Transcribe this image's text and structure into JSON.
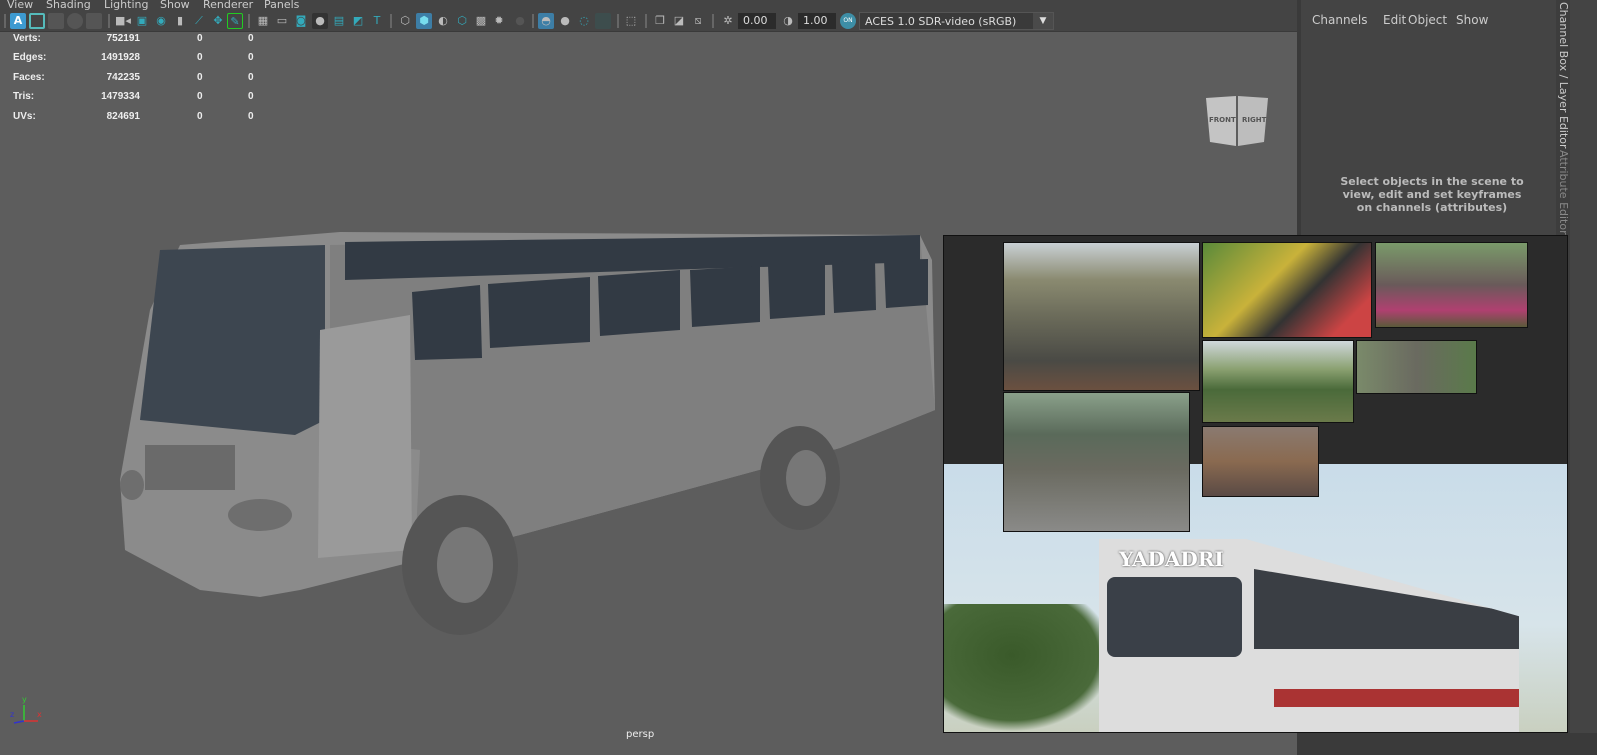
{
  "menubar": {
    "items": [
      "View",
      "Shading",
      "Lighting",
      "Show",
      "Renderer",
      "Panels"
    ]
  },
  "toolbar": {
    "exposure": "0.00",
    "gamma": "1.00",
    "color_mgmt_toggle": "ON",
    "color_space": "ACES 1.0 SDR-video (sRGB)"
  },
  "stats": [
    {
      "label": "Verts:",
      "total": "752191",
      "sel": "0",
      "comp": "0"
    },
    {
      "label": "Edges:",
      "total": "1491928",
      "sel": "0",
      "comp": "0"
    },
    {
      "label": "Faces:",
      "total": "742235",
      "sel": "0",
      "comp": "0"
    },
    {
      "label": "Tris:",
      "total": "1479334",
      "sel": "0",
      "comp": "0"
    },
    {
      "label": "UVs:",
      "total": "824691",
      "sel": "0",
      "comp": "0"
    }
  ],
  "viewcube": {
    "front": "FRONT",
    "right": "RIGHT"
  },
  "axis": {
    "x": "x",
    "y": "y",
    "z": "z"
  },
  "camera_label": "persp",
  "channel_box": {
    "menu": [
      "Channels",
      "Edit",
      "Object",
      "Show"
    ],
    "message": "Select objects in the scene to view, edit and set keyframes on channels (attributes)"
  },
  "side_tabs": [
    "Channel Box / Layer Editor",
    "Attribute Editor"
  ],
  "reference_image": {
    "bus_name": "YADADRI"
  }
}
